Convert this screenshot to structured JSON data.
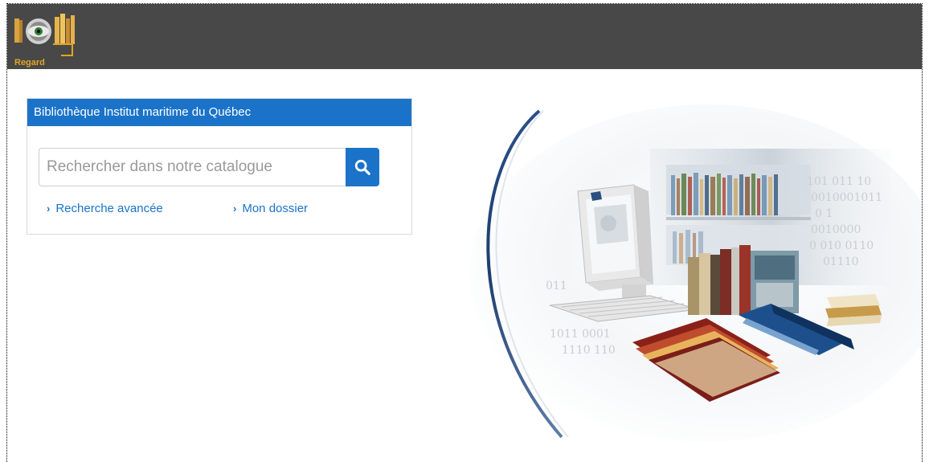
{
  "header": {
    "logo_text": "Regard",
    "logo_icon": "eye-books-logo-icon"
  },
  "search_panel": {
    "title": "Bibliothèque Institut maritime du Québec",
    "search_placeholder": "Rechercher dans notre catalogue",
    "search_icon": "search-icon",
    "links": [
      {
        "label": "Recherche avancée",
        "icon": "chevron-right-icon"
      },
      {
        "label": "Mon dossier",
        "icon": "chevron-right-icon"
      }
    ]
  },
  "hero": {
    "binary_lines": [
      "101 011 10",
      "0010001011",
      "0 1",
      "0010000",
      "0 010 0110",
      "01110",
      "011",
      "1011 0001",
      "1110 110"
    ]
  },
  "colors": {
    "topbar": "#484848",
    "accent": "#1b73c9",
    "logo_gold": "#e3a321"
  }
}
